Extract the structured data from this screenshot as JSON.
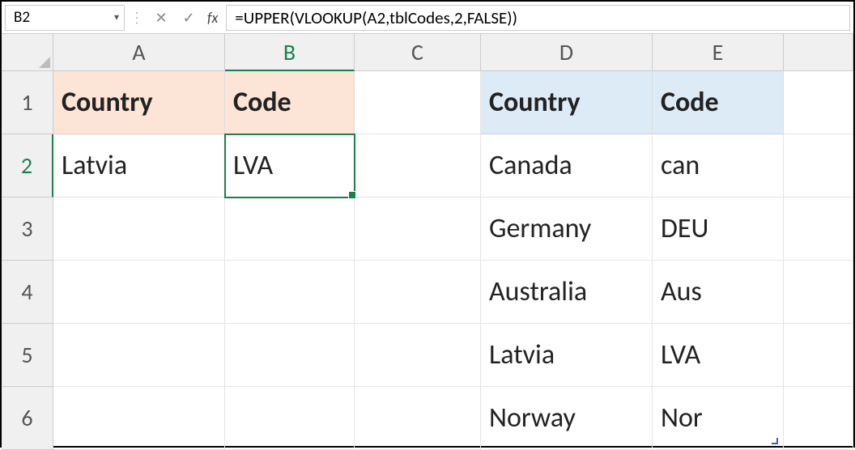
{
  "formula_bar": {
    "cell_ref": "B2",
    "fx_label": "fx",
    "formula": "=UPPER(VLOOKUP(A2,tblCodes,2,FALSE))"
  },
  "columns": [
    "A",
    "B",
    "C",
    "D",
    "E"
  ],
  "rows": [
    "1",
    "2",
    "3",
    "4",
    "5",
    "6"
  ],
  "active": {
    "col": "B",
    "row": "2"
  },
  "data": {
    "A1": "Country",
    "B1": "Code",
    "A2": "Latvia",
    "B2": "LVA",
    "D1": "Country",
    "E1": "Code",
    "D2": "Canada",
    "E2": "can",
    "D3": "Germany",
    "E3": "DEU",
    "D4": "Australia",
    "E4": "Aus",
    "D5": "Latvia",
    "E5": "LVA",
    "D6": "Norway",
    "E6": "Nor"
  }
}
